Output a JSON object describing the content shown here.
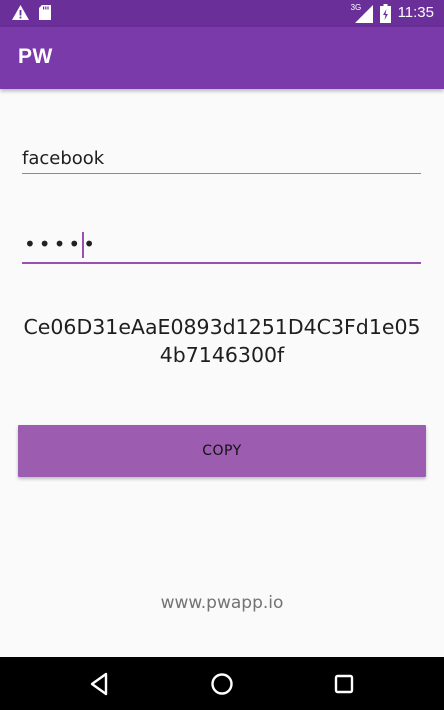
{
  "status_bar": {
    "time": "11:35",
    "network_label": "3G",
    "icons": [
      "warning-icon",
      "sd-card-icon",
      "signal-icon",
      "battery-icon"
    ]
  },
  "app_bar": {
    "title": "PW",
    "background": "#7b3aaa"
  },
  "form": {
    "site_value": "facebook",
    "password_masked": "•••••",
    "generated_password": "Ce06D31eAaE0893d1251D4C3Fd1e054b7146300f",
    "copy_label": "COPY",
    "accent_color": "#9c5cb0"
  },
  "footer": {
    "link_text": "www.pwapp.io"
  },
  "nav_bar": {
    "icons": [
      "back-icon",
      "home-icon",
      "recents-icon"
    ]
  }
}
